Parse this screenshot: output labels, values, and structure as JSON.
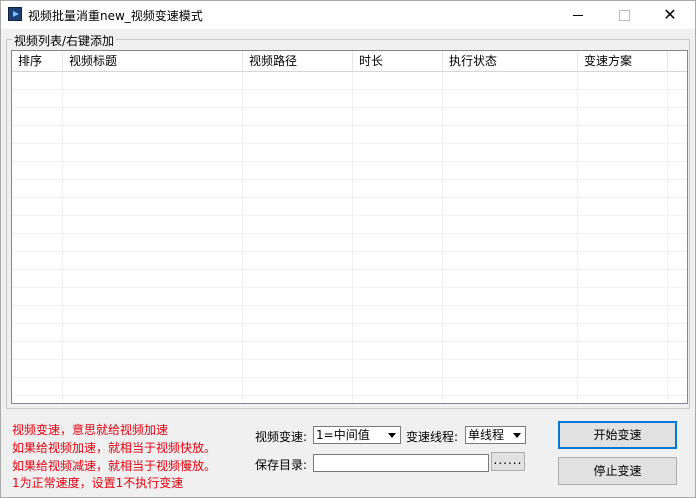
{
  "window": {
    "title": "视频批量消重new_视频变速模式",
    "icon": "video-app-icon"
  },
  "titlebar_controls": {
    "minimize": "minimize-icon",
    "maximize": "maximize-icon",
    "close": "close-icon",
    "close_glyph": "✕"
  },
  "video_group": {
    "legend": "视频列表/右键添加",
    "columns": [
      "排序",
      "视频标题",
      "视频路径",
      "时长",
      "执行状态",
      "变速方案"
    ],
    "rows": []
  },
  "hints": [
    "视频变速，意思就给视频加速",
    "如果给视频加速，就相当于视频快放。",
    "如果给视频减速，就相当于视频慢放。",
    "1为正常速度，设置1不执行变速"
  ],
  "controls": {
    "speed_label": "视频变速:",
    "speed_value": "1=中间值",
    "thread_label": "变速线程:",
    "thread_value": "单线程",
    "save_dir_label": "保存目录:",
    "save_dir_value": "",
    "browse_label": "......",
    "start_label": "开始变速",
    "stop_label": "停止变速"
  },
  "colors": {
    "hint_text": "#e8000e",
    "focus_border": "#0078d7"
  }
}
